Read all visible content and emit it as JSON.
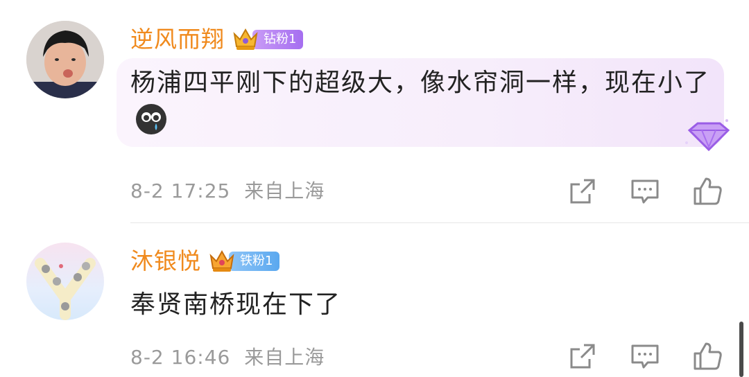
{
  "comments": [
    {
      "username": "逆风而翔",
      "fan_badge": "钻粉1",
      "text": "杨浦四平刚下的超级大，像水帘洞一样，现在小了",
      "date": "8-2 17:25",
      "location": "来自上海",
      "emoji_icon": "crying-face-emoji-icon",
      "badge_color": "#a56ef0"
    },
    {
      "username": "沐银悦",
      "fan_badge": "铁粉1",
      "text": "奉贤南桥现在下了",
      "date": "8-2 16:46",
      "location": "来自上海",
      "badge_color": "#5aa8ef"
    }
  ],
  "colors": {
    "username": "#f08a1d",
    "text": "#222222",
    "meta": "#9a9a9a",
    "icon": "#8a8a8a"
  }
}
